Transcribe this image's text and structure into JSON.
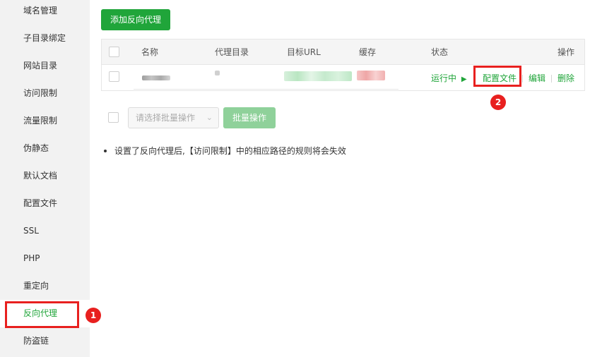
{
  "sidebar": {
    "items": [
      {
        "label": "域名管理"
      },
      {
        "label": "子目录绑定"
      },
      {
        "label": "网站目录"
      },
      {
        "label": "访问限制"
      },
      {
        "label": "流量限制"
      },
      {
        "label": "伪静态"
      },
      {
        "label": "默认文档"
      },
      {
        "label": "配置文件"
      },
      {
        "label": "SSL"
      },
      {
        "label": "PHP"
      },
      {
        "label": "重定向"
      },
      {
        "label": "反向代理"
      },
      {
        "label": "防盗链"
      }
    ],
    "active_index": 11
  },
  "toolbar": {
    "add_label": "添加反向代理"
  },
  "table": {
    "headers": {
      "name": "名称",
      "proxy_dir": "代理目录",
      "target_url": "目标URL",
      "cache": "缓存",
      "status": "状态",
      "actions": "操作"
    },
    "row": {
      "status": "运行中",
      "status_icon": "play-icon",
      "config_label": "配置文件",
      "edit_label": "编辑",
      "delete_label": "删除"
    }
  },
  "batch": {
    "select_placeholder": "请选择批量操作",
    "button_label": "批量操作"
  },
  "tip": {
    "text": "设置了反向代理后,【访问限制】中的相应路径的规则将会失效"
  },
  "annotations": {
    "badge1": "1",
    "badge2": "2"
  },
  "colors": {
    "accent": "#20a53a",
    "highlight": "#e8201f"
  }
}
